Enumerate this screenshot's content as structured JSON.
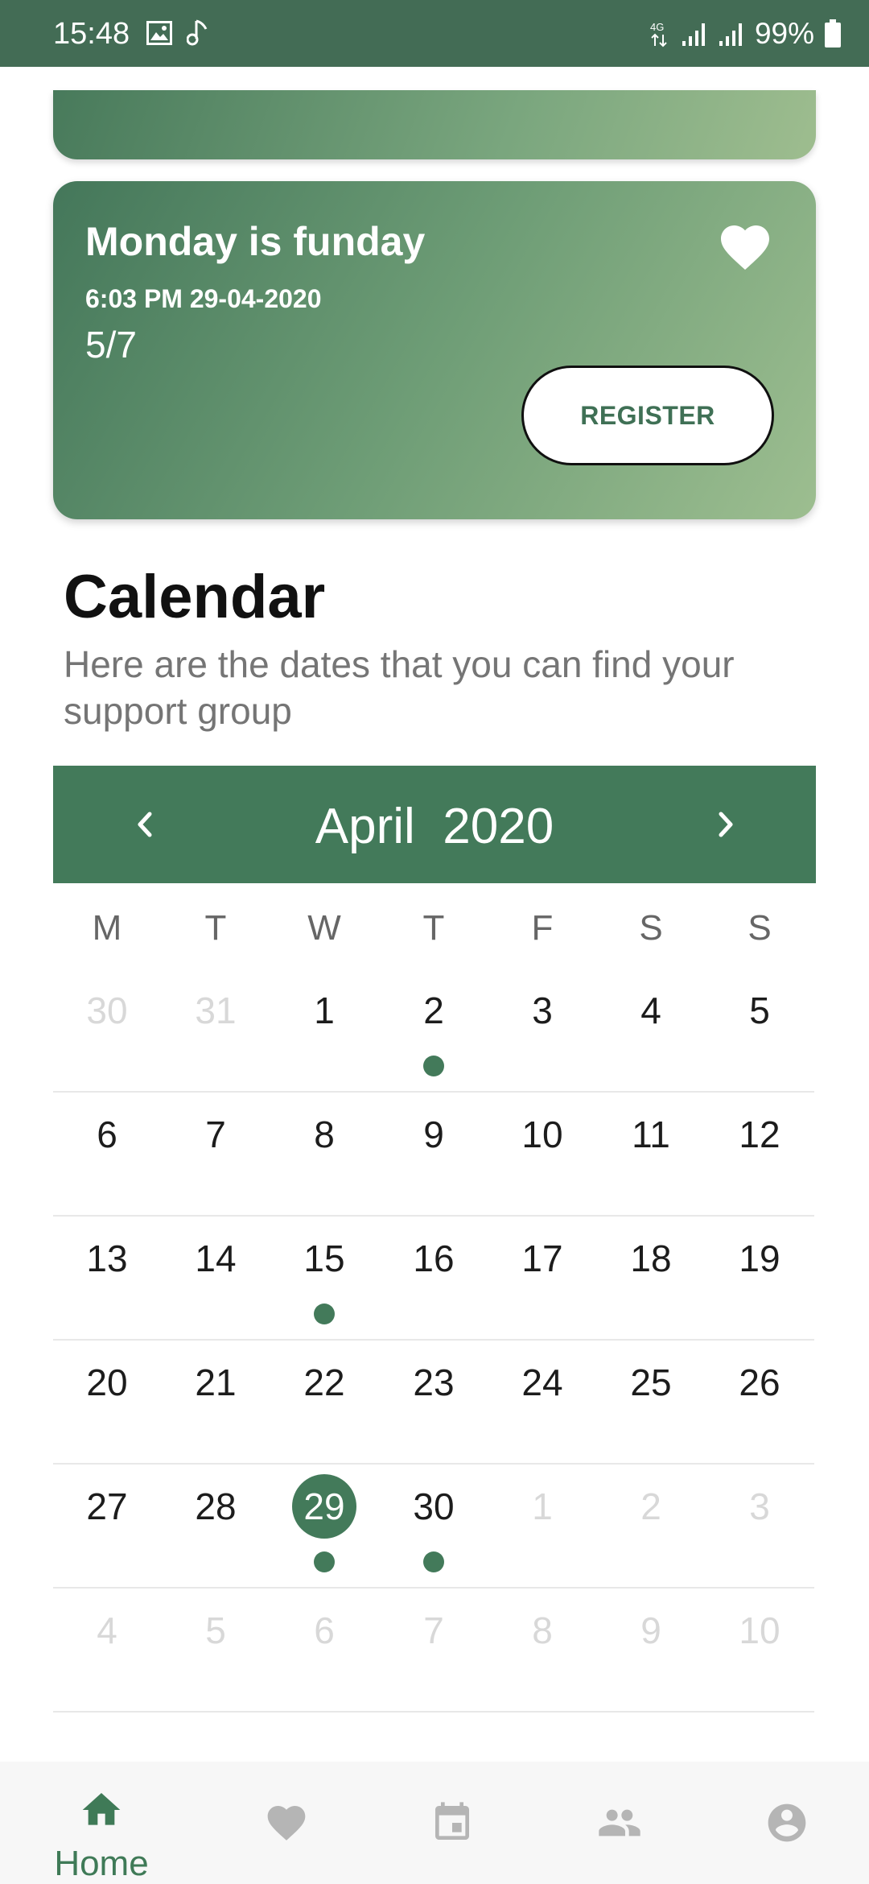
{
  "status_bar": {
    "time": "15:48",
    "network": "4G",
    "battery": "99%"
  },
  "event_card": {
    "title": "Monday is funday",
    "datetime": "6:03 PM 29-04-2020",
    "count": "5/7",
    "register_label": "REGISTER",
    "favorite_icon": "heart-icon"
  },
  "calendar": {
    "title": "Calendar",
    "subtitle": "Here are the dates that you can find your support group",
    "month": "April",
    "year": "2020",
    "weekdays": [
      "M",
      "T",
      "W",
      "T",
      "F",
      "S",
      "S"
    ],
    "weeks": [
      [
        "30",
        "31",
        "1",
        "2",
        "3",
        "4",
        "5"
      ],
      [
        "6",
        "7",
        "8",
        "9",
        "10",
        "11",
        "12"
      ],
      [
        "13",
        "14",
        "15",
        "16",
        "17",
        "18",
        "19"
      ],
      [
        "20",
        "21",
        "22",
        "23",
        "24",
        "25",
        "26"
      ],
      [
        "27",
        "28",
        "29",
        "30",
        "1",
        "2",
        "3"
      ],
      [
        "4",
        "5",
        "6",
        "7",
        "8",
        "9",
        "10"
      ]
    ],
    "muted_days_note": "outside current month shown grey",
    "selected_day": "29",
    "event_days": [
      "2",
      "15",
      "29",
      "30"
    ],
    "accent_color": "#437a5a"
  },
  "bottom_nav": {
    "items": [
      {
        "label": "Home",
        "icon": "home-icon",
        "active": true
      },
      {
        "label": "",
        "icon": "heart-icon",
        "active": false
      },
      {
        "label": "",
        "icon": "calendar-icon",
        "active": false
      },
      {
        "label": "",
        "icon": "group-icon",
        "active": false
      },
      {
        "label": "",
        "icon": "account-icon",
        "active": false
      }
    ]
  }
}
